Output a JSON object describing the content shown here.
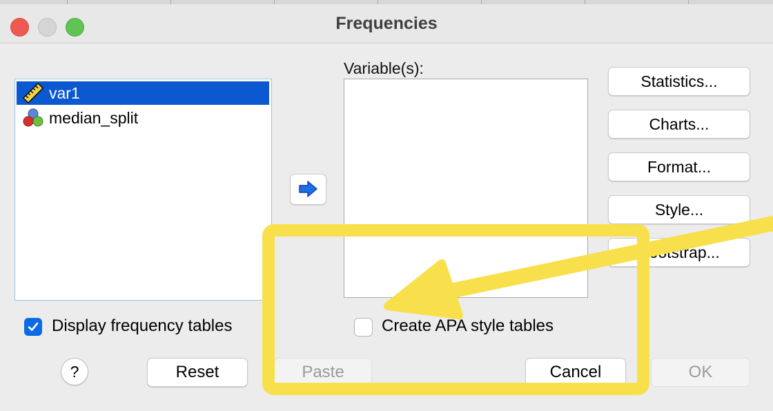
{
  "window": {
    "title": "Frequencies"
  },
  "source_list": {
    "items": [
      {
        "label": "var1",
        "icon": "scale-ruler-icon",
        "selected": true
      },
      {
        "label": "median_split",
        "icon": "nominal-balls-icon",
        "selected": false
      }
    ]
  },
  "target_list": {
    "label": "Variable(s):",
    "items": []
  },
  "move_button": {
    "icon": "move-right-arrow-icon"
  },
  "side_buttons": {
    "statistics": "Statistics...",
    "charts": "Charts...",
    "format": "Format...",
    "style": "Style...",
    "bootstrap": "Bootstrap..."
  },
  "options": {
    "display_frequency_tables": {
      "label": "Display frequency tables",
      "checked": true
    },
    "create_apa_style_tables": {
      "label": "Create APA style tables",
      "checked": false
    }
  },
  "footer": {
    "help": "?",
    "reset": "Reset",
    "paste": "Paste",
    "cancel": "Cancel",
    "ok": "OK"
  },
  "annotation": {
    "color": "#f7e04b"
  },
  "colors": {
    "selection": "#0b58d1",
    "checkbox_accent": "#0b6be6",
    "close": "#ee5a52",
    "maximize": "#5fc453"
  }
}
